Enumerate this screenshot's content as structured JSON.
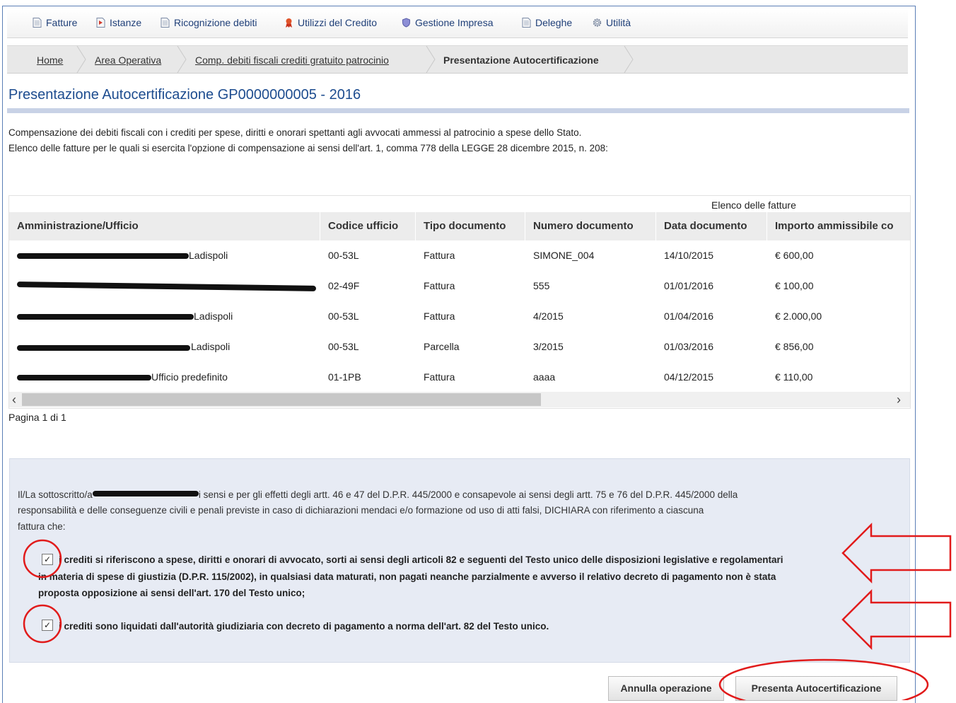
{
  "nav": {
    "items": [
      {
        "label": "Fatture",
        "icon": "document-icon"
      },
      {
        "label": "Istanze",
        "icon": "document-flag-icon"
      },
      {
        "label": "Ricognizione debiti",
        "icon": "document-icon"
      },
      {
        "label": "Utilizzi del Credito",
        "icon": "ribbon-icon"
      },
      {
        "label": "Gestione Impresa",
        "icon": "shield-icon"
      },
      {
        "label": "Deleghe",
        "icon": "document-icon"
      },
      {
        "label": "Utilità",
        "icon": "gear-icon"
      }
    ]
  },
  "breadcrumb": {
    "home": "Home",
    "area": "Area Operativa",
    "comp": "Comp. debiti fiscali crediti gratuito patrocinio",
    "current": "Presentazione Autocertificazione"
  },
  "page": {
    "title": "Presentazione Autocertificazione GP0000000005 - 2016",
    "intro1": "Compensazione dei debiti fiscali con i crediti per spese, diritti e onorari spettanti agli avvocati ammessi al patrocinio a spese dello Stato.",
    "intro2": "Elenco delle fatture per le quali si esercita l'opzione di compensazione ai sensi dell'art. 1, comma 778 della LEGGE 28 dicembre 2015, n. 208:"
  },
  "table": {
    "caption": "Elenco delle fatture",
    "headers": [
      "Amministrazione/Ufficio",
      "Codice ufficio",
      "Tipo documento",
      "Numero documento",
      "Data documento",
      "Importo ammissibile co"
    ],
    "rows": [
      {
        "amm": "Ladispoli",
        "codice": "00-53L",
        "tipo": "Fattura",
        "numero": "SIMONE_004",
        "data": "14/10/2015",
        "importo": "€ 600,00"
      },
      {
        "amm": "",
        "codice": "02-49F",
        "tipo": "Fattura",
        "numero": "555",
        "data": "01/01/2016",
        "importo": "€ 100,00"
      },
      {
        "amm": "Ladispoli",
        "codice": "00-53L",
        "tipo": "Fattura",
        "numero": "4/2015",
        "data": "01/04/2016",
        "importo": "€ 2.000,00"
      },
      {
        "amm": "Ladispoli",
        "codice": "00-53L",
        "tipo": "Parcella",
        "numero": "3/2015",
        "data": "01/03/2016",
        "importo": "€ 856,00"
      },
      {
        "amm": "Ufficio predefinito",
        "codice": "01-1PB",
        "tipo": "Fattura",
        "numero": "aaaa",
        "data": "04/12/2015",
        "importo": "€ 110,00"
      }
    ],
    "pager": "Pagina 1 di 1"
  },
  "declaration": {
    "line1a": "Il/La sottoscritto/a",
    "line1b": "i sensi e per gli effetti degli artt. 46 e 47 del D.P.R. 445/2000 e consapevole ai sensi degli artt. 75 e 76 del D.P.R. 445/2000 della",
    "line2": "responsabilità e delle conseguenze civili e penali previste in caso di dichiarazioni mendaci e/o formazione od uso di atti falsi, DICHIARA con riferimento a ciascuna",
    "line3": "fattura che:",
    "check1_line1": "i crediti si riferiscono a spese, diritti e onorari di avvocato, sorti ai sensi degli articoli 82 e seguenti del Testo unico delle disposizioni legislative e regolamentari",
    "check1_line2": "in materia di spese di giustizia (D.P.R. 115/2002), in qualsiasi data maturati, non pagati neanche parzialmente e avverso il relativo decreto di pagamento non è stata",
    "check1_line3": "proposta opposizione ai sensi dell'art. 170 del Testo unico;",
    "check1_checked": true,
    "check2_text": "i crediti sono liquidati dall'autorità giudiziaria con decreto di pagamento a norma dell'art. 82 del Testo unico.",
    "check2_checked": true
  },
  "buttons": {
    "cancel": "Annulla operazione",
    "submit": "Presenta Autocertificazione"
  },
  "colors": {
    "annotation": "#e11b1b",
    "title": "#1d4c8f",
    "nav_text": "#1f3f78"
  }
}
